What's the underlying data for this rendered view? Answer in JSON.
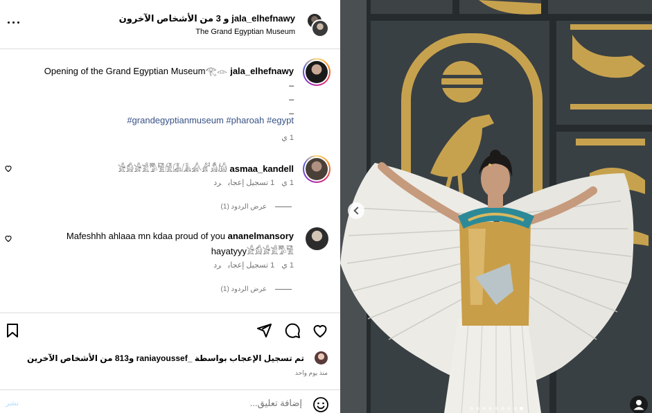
{
  "header": {
    "title": "jala_elhefnawy و 3 من الأشخاص الآخرون",
    "location": "The Grand Egyptian Museum"
  },
  "caption": {
    "username": "jala_elhefnawy",
    "text": "Opening of the Grand Egyptian Museum𓂀𓁹",
    "dashes": [
      "_",
      "_",
      "_"
    ],
    "hashtags": "#grandegyptianmuseum #pharoah #egypt",
    "age": "1 ي"
  },
  "comments": [
    {
      "username": "asmaa_kandell",
      "text": "𓀀𓀁𓀂𓀃𓀄𓀅𓀆𓀇𓀈𓀉𓀊𓀋𓀌",
      "age": "1 ي",
      "likes": "1 تسجيل إعجاب",
      "reply": "رد",
      "view_replies": "عرض الردود (1)"
    },
    {
      "username": "ananelmansory",
      "text": "Mafeshhh ahlaaa mn kdaa proud of you",
      "text2": "hayatyyy𓀀𓀁𓀂𓀃𓀄𓀅",
      "age": "1 ي",
      "likes": "1 تسجيل إعجاب",
      "reply": "رد",
      "view_replies": "عرض الردود (1)"
    }
  ],
  "likes_line": "تم تسجيل الإعجاب بواسطة _raniayoussef و813 من الأشخاص الآخرين",
  "timestamp": "منذ يوم واحد",
  "comment_box": {
    "placeholder": "إضافة تعليق...",
    "post_label": "نشر"
  },
  "icons": {
    "more": "more-icon",
    "bookmark": "bookmark-icon",
    "share": "share-icon",
    "comment": "comment-icon",
    "like": "heart-icon",
    "emoji": "emoji-icon",
    "tag": "user-tag-icon"
  },
  "carousel": {
    "current": 9,
    "total": 9
  },
  "colors": {
    "link": "#385185",
    "muted": "#737373",
    "post_disabled": "#b2dffc"
  }
}
